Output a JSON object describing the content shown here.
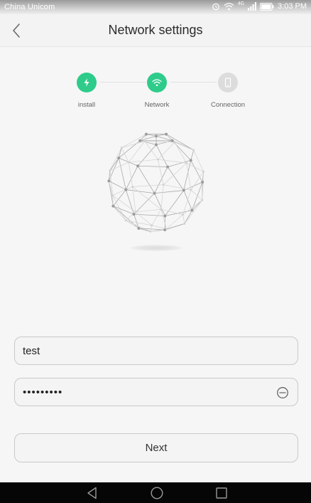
{
  "status_bar": {
    "carrier": "China Unicom",
    "network_badge": "4G",
    "time": "3:03 PM"
  },
  "header": {
    "title": "Network settings",
    "back_icon": "chevron-left-icon"
  },
  "steps": [
    {
      "label": "install",
      "icon": "lightning-icon",
      "state": "done"
    },
    {
      "label": "Network",
      "icon": "wifi-icon",
      "state": "active"
    },
    {
      "label": "Connection",
      "icon": "phone-icon",
      "state": "pending"
    }
  ],
  "form": {
    "ssid_value": "test",
    "password_value": "•••••••••",
    "password_toggle_icon": "eye-closed-icon"
  },
  "next_button": {
    "label": "Next"
  },
  "colors": {
    "accent": "#2ecb8a",
    "inactive": "#dcdcdc",
    "background": "#f6f6f6"
  }
}
